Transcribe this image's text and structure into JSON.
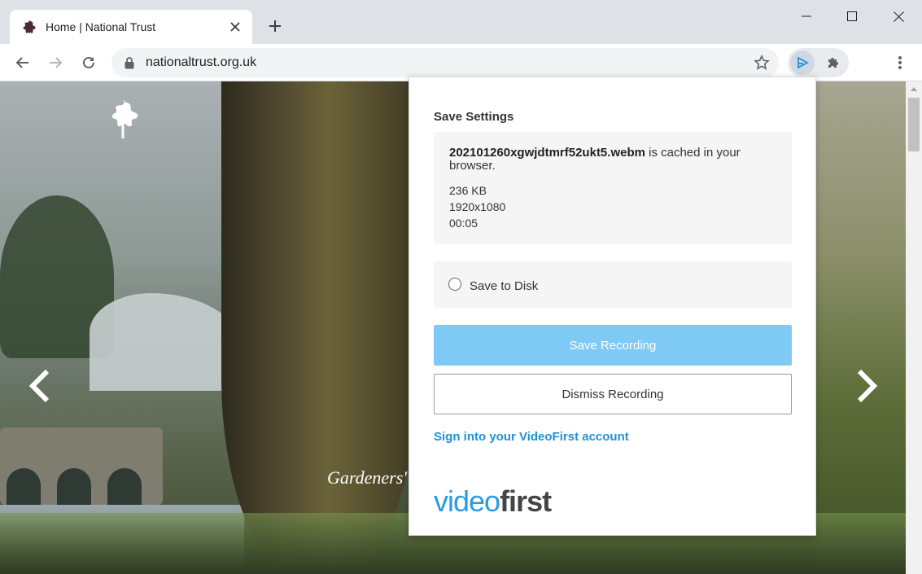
{
  "browser": {
    "tab": {
      "title": "Home | National Trust"
    },
    "url": "nationaltrust.org.uk"
  },
  "icons": {
    "favicon": "oak-leaf-icon",
    "close_tab": "close-icon",
    "new_tab": "plus-icon",
    "back": "arrow-left-icon",
    "forward": "arrow-right-icon",
    "reload": "reload-icon",
    "lock": "lock-icon",
    "bookmark": "star-icon",
    "extension": "videofirst-play-icon",
    "extensions_menu": "puzzle-icon",
    "menu": "kebab-menu-icon"
  },
  "page": {
    "hero_caption": "Gardeners' "
  },
  "popup": {
    "heading": "Save Settings",
    "file_name": "202101260xgwjdtmrf52ukt5.webm",
    "cached_msg": " is cached in your browser.",
    "size": "236 KB",
    "resolution": "1920x1080",
    "duration": "00:05",
    "save_to_disk_label": "Save to Disk",
    "save_button": "Save Recording",
    "dismiss_button": "Dismiss Recording",
    "signin_link": "Sign into your VideoFirst account",
    "logo_part1": "video",
    "logo_part2": "first"
  },
  "colors": {
    "accent_blue": "#2191d6",
    "save_button_bg": "#7fcaf4",
    "card_bg": "#f5f5f5"
  }
}
